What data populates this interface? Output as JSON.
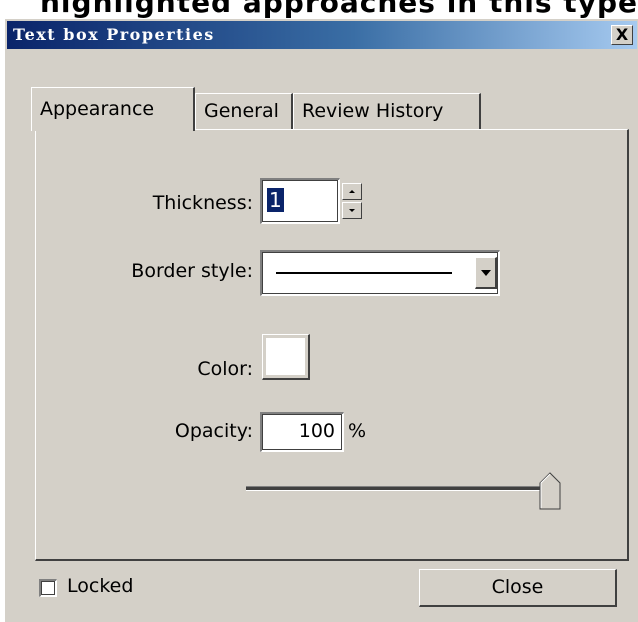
{
  "top_cropped_text": "highlighted approaches in this type",
  "dialog": {
    "title": "Text box Properties",
    "close_glyph": "X"
  },
  "tabs": [
    {
      "label": "Appearance",
      "active": true
    },
    {
      "label": "General",
      "active": false
    },
    {
      "label": "Review History",
      "active": false
    }
  ],
  "appearance": {
    "thickness": {
      "label": "Thickness:",
      "value": "1"
    },
    "border_style": {
      "label": "Border style:",
      "selected": "solid line"
    },
    "color": {
      "label": "Color:",
      "value": "#ffffff"
    },
    "opacity": {
      "label": "Opacity:",
      "value": "100",
      "unit": "%",
      "slider_fraction": 1.0
    }
  },
  "footer": {
    "locked_label": "Locked",
    "locked_checked": false,
    "close_label": "Close"
  },
  "colors": {
    "dialog_bg": "#d4d0c8",
    "title_start": "#0a246a",
    "title_end": "#a6caf0",
    "selection": "#0a246a"
  }
}
